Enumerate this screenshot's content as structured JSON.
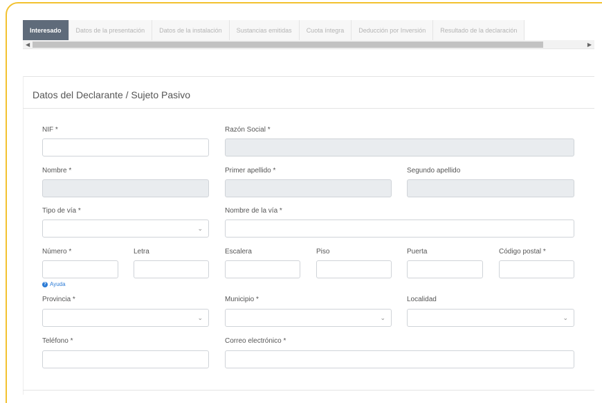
{
  "tabs": [
    {
      "label": "Interesado",
      "active": true
    },
    {
      "label": "Datos de la presentación",
      "active": false
    },
    {
      "label": "Datos de la instalación",
      "active": false
    },
    {
      "label": "Sustancias emitidas",
      "active": false
    },
    {
      "label": "Cuota íntegra",
      "active": false
    },
    {
      "label": "Deducción por Inversión",
      "active": false
    },
    {
      "label": "Resultado de la declaración",
      "active": false
    }
  ],
  "section": {
    "title": "Datos del Declarante / Sujeto Pasivo"
  },
  "form": {
    "nif": {
      "label": "NIF *",
      "value": ""
    },
    "razon_social": {
      "label": "Razón Social *",
      "value": ""
    },
    "nombre": {
      "label": "Nombre *",
      "value": ""
    },
    "primer_apellido": {
      "label": "Primer apellido *",
      "value": ""
    },
    "segundo_apellido": {
      "label": "Segundo apellido",
      "value": ""
    },
    "tipo_via": {
      "label": "Tipo de vía *",
      "value": ""
    },
    "nombre_via": {
      "label": "Nombre de la vía *",
      "value": ""
    },
    "numero": {
      "label": "Número *",
      "value": ""
    },
    "letra": {
      "label": "Letra",
      "value": ""
    },
    "escalera": {
      "label": "Escalera",
      "value": ""
    },
    "piso": {
      "label": "Piso",
      "value": ""
    },
    "puerta": {
      "label": "Puerta",
      "value": ""
    },
    "codigo_postal": {
      "label": "Código postal *",
      "value": ""
    },
    "ayuda": {
      "label": "Ayuda"
    },
    "provincia": {
      "label": "Provincia *",
      "value": ""
    },
    "municipio": {
      "label": "Municipio *",
      "value": ""
    },
    "localidad": {
      "label": "Localidad",
      "value": ""
    },
    "telefono": {
      "label": "Teléfono *",
      "value": ""
    },
    "correo": {
      "label": "Correo electrónico *",
      "value": ""
    }
  },
  "colors": {
    "accent_border": "#f2c12e",
    "active_tab": "#5f6b7a",
    "help_link": "#2b7bd6"
  }
}
